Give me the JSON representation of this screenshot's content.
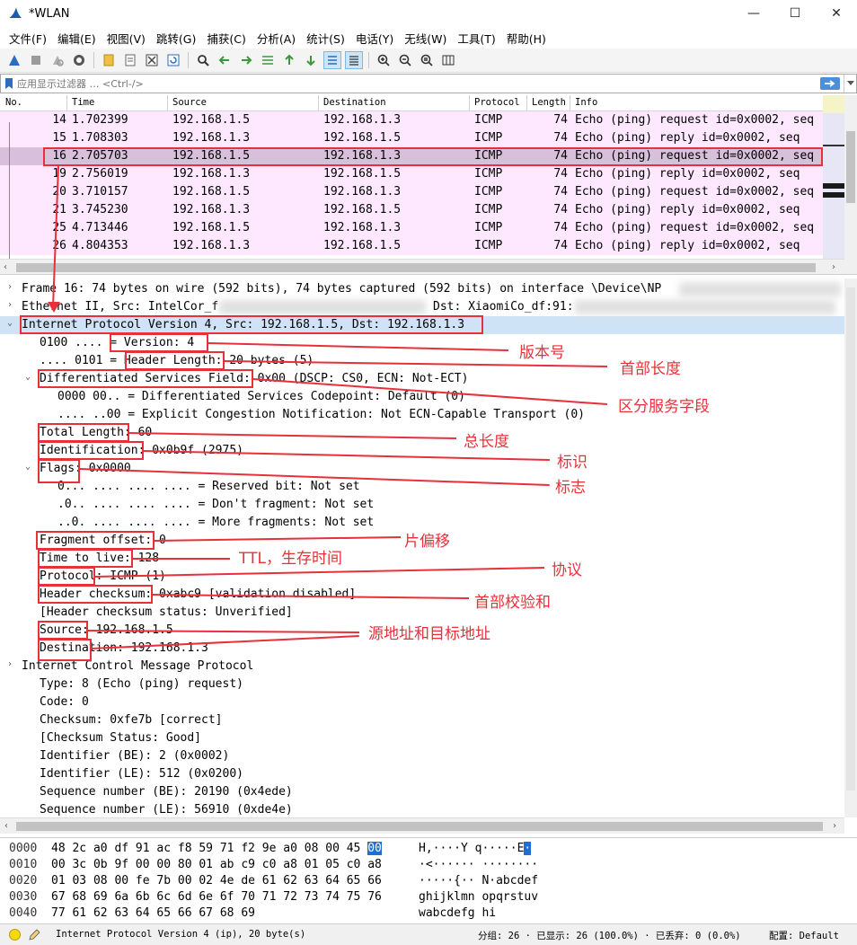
{
  "window": {
    "title": "*WLAN",
    "minimize": "—",
    "maximize": "☐",
    "close": "✕"
  },
  "menu": [
    "文件(F)",
    "编辑(E)",
    "视图(V)",
    "跳转(G)",
    "捕获(C)",
    "分析(A)",
    "统计(S)",
    "电话(Y)",
    "无线(W)",
    "工具(T)",
    "帮助(H)"
  ],
  "filter": {
    "placeholder": "应用显示过滤器 … <Ctrl-/>"
  },
  "packet_list": {
    "columns": [
      "No.",
      "Time",
      "Source",
      "Destination",
      "Protocol",
      "Length",
      "Info"
    ],
    "rows": [
      {
        "no": "14",
        "time": "1.702399",
        "src": "192.168.1.5",
        "dst": "192.168.1.3",
        "proto": "ICMP",
        "len": "74",
        "info": "Echo (ping) request  id=0x0002, seq"
      },
      {
        "no": "15",
        "time": "1.708303",
        "src": "192.168.1.3",
        "dst": "192.168.1.5",
        "proto": "ICMP",
        "len": "74",
        "info": "Echo (ping) reply    id=0x0002, seq"
      },
      {
        "no": "16",
        "time": "2.705703",
        "src": "192.168.1.5",
        "dst": "192.168.1.3",
        "proto": "ICMP",
        "len": "74",
        "info": "Echo (ping) request  id=0x0002, seq"
      },
      {
        "no": "19",
        "time": "2.756019",
        "src": "192.168.1.3",
        "dst": "192.168.1.5",
        "proto": "ICMP",
        "len": "74",
        "info": "Echo (ping) reply    id=0x0002, seq"
      },
      {
        "no": "20",
        "time": "3.710157",
        "src": "192.168.1.5",
        "dst": "192.168.1.3",
        "proto": "ICMP",
        "len": "74",
        "info": "Echo (ping) request  id=0x0002, seq"
      },
      {
        "no": "21",
        "time": "3.745230",
        "src": "192.168.1.3",
        "dst": "192.168.1.5",
        "proto": "ICMP",
        "len": "74",
        "info": "Echo (ping) reply    id=0x0002, seq"
      },
      {
        "no": "25",
        "time": "4.713446",
        "src": "192.168.1.5",
        "dst": "192.168.1.3",
        "proto": "ICMP",
        "len": "74",
        "info": "Echo (ping) request  id=0x0002, seq"
      },
      {
        "no": "26",
        "time": "4.804353",
        "src": "192.168.1.3",
        "dst": "192.168.1.5",
        "proto": "ICMP",
        "len": "74",
        "info": "Echo (ping) reply    id=0x0002, seq"
      }
    ]
  },
  "details": [
    {
      "level": 0,
      "arrow": "›",
      "text": "Frame 16: 74 bytes on wire (592 bits), 74 bytes captured (592 bits) on interface \\Device\\NP"
    },
    {
      "level": 0,
      "arrow": "›",
      "text": "Ethernet II, Src: IntelCor_f",
      "extra": "Dst: XiaomiCo_df:91:"
    },
    {
      "level": 0,
      "arrow": "⌄",
      "text": "Internet Protocol Version 4, Src: 192.168.1.5, Dst: 192.168.1.3"
    },
    {
      "level": 1,
      "arrow": "",
      "text": "0100 .... = Version: 4"
    },
    {
      "level": 1,
      "arrow": "",
      "text": ".... 0101 = Header Length: 20 bytes (5)"
    },
    {
      "level": 1,
      "arrow": "⌄",
      "text": "Differentiated Services Field: 0x00 (DSCP: CS0, ECN: Not-ECT)"
    },
    {
      "level": 2,
      "arrow": "",
      "text": "0000 00.. = Differentiated Services Codepoint: Default (0)"
    },
    {
      "level": 2,
      "arrow": "",
      "text": ".... ..00 = Explicit Congestion Notification: Not ECN-Capable Transport (0)"
    },
    {
      "level": 1,
      "arrow": "",
      "text": "Total Length: 60"
    },
    {
      "level": 1,
      "arrow": "",
      "text": "Identification: 0x0b9f (2975)"
    },
    {
      "level": 1,
      "arrow": "⌄",
      "text": "Flags: 0x0000"
    },
    {
      "level": 2,
      "arrow": "",
      "text": "0... .... .... .... = Reserved bit: Not set"
    },
    {
      "level": 2,
      "arrow": "",
      "text": ".0.. .... .... .... = Don't fragment: Not set"
    },
    {
      "level": 2,
      "arrow": "",
      "text": "..0. .... .... .... = More fragments: Not set"
    },
    {
      "level": 1,
      "arrow": "",
      "text": "Fragment offset: 0"
    },
    {
      "level": 1,
      "arrow": "",
      "text": "Time to live: 128"
    },
    {
      "level": 1,
      "arrow": "",
      "text": "Protocol: ICMP (1)"
    },
    {
      "level": 1,
      "arrow": "",
      "text": "Header checksum: 0xabc9 [validation disabled]"
    },
    {
      "level": 1,
      "arrow": "",
      "text": "[Header checksum status: Unverified]"
    },
    {
      "level": 1,
      "arrow": "",
      "text": "Source: 192.168.1.5"
    },
    {
      "level": 1,
      "arrow": "",
      "text": "Destination: 192.168.1.3"
    },
    {
      "level": 0,
      "arrow": "›",
      "text": "Internet Control Message Protocol"
    },
    {
      "level": 1,
      "arrow": "",
      "text": "Type: 8 (Echo (ping) request)"
    },
    {
      "level": 1,
      "arrow": "",
      "text": "Code: 0"
    },
    {
      "level": 1,
      "arrow": "",
      "text": "Checksum: 0xfe7b [correct]"
    },
    {
      "level": 1,
      "arrow": "",
      "text": "[Checksum Status: Good]"
    },
    {
      "level": 1,
      "arrow": "",
      "text": "Identifier (BE): 2 (0x0002)"
    },
    {
      "level": 1,
      "arrow": "",
      "text": "Identifier (LE): 512 (0x0200)"
    },
    {
      "level": 1,
      "arrow": "",
      "text": "Sequence number (BE): 20190 (0x4ede)"
    },
    {
      "level": 1,
      "arrow": "",
      "text": "Sequence number (LE): 56910 (0xde4e)"
    }
  ],
  "hex": [
    {
      "off": "0000",
      "bytes": "48 2c a0 df 91 ac f8 59  71 f2 9e a0 08 00 45 ",
      "sel": "00",
      "ascii": "H,····Y q·····E",
      "ascii_sel": "·"
    },
    {
      "off": "0010",
      "bytes": "00 3c 0b 9f 00 00 80 01  ab c9 c0 a8 01 05 c0 a8",
      "sel": "",
      "ascii": "·<······ ········",
      "ascii_sel": ""
    },
    {
      "off": "0020",
      "bytes": "01 03 08 00 fe 7b 00 02  4e de 61 62 63 64 65 66",
      "sel": "",
      "ascii": "·····{·· N·abcdef",
      "ascii_sel": ""
    },
    {
      "off": "0030",
      "bytes": "67 68 69 6a 6b 6c 6d 6e  6f 70 71 72 73 74 75 76",
      "sel": "",
      "ascii": "ghijklmn opqrstuv",
      "ascii_sel": ""
    },
    {
      "off": "0040",
      "bytes": "77 61 62 63 64 65 66 67  68 69",
      "sel": "",
      "ascii": "wabcdefg hi",
      "ascii_sel": ""
    }
  ],
  "status": {
    "field": "Internet Protocol Version 4 (ip), 20 byte(s)",
    "packets": "分组: 26 · 已显示: 26 (100.0%) · 已丢弃: 0 (0.0%)",
    "profile": "配置: Default"
  },
  "annotations": {
    "version": "版本号",
    "header_length": "首部长度",
    "dsf": "区分服务字段",
    "total_length": "总长度",
    "identification": "标识",
    "flags": "标志",
    "fragment_offset": "片偏移",
    "ttl": "TTL，生存时间",
    "protocol": "协议",
    "checksum": "首部校验和",
    "addresses": "源地址和目标地址"
  },
  "colors": {
    "row_bg": "#fde8ff",
    "row_sel": "#d8bfdc",
    "tree_sel": "#cfe3f7",
    "annotation": "#e8303a"
  }
}
